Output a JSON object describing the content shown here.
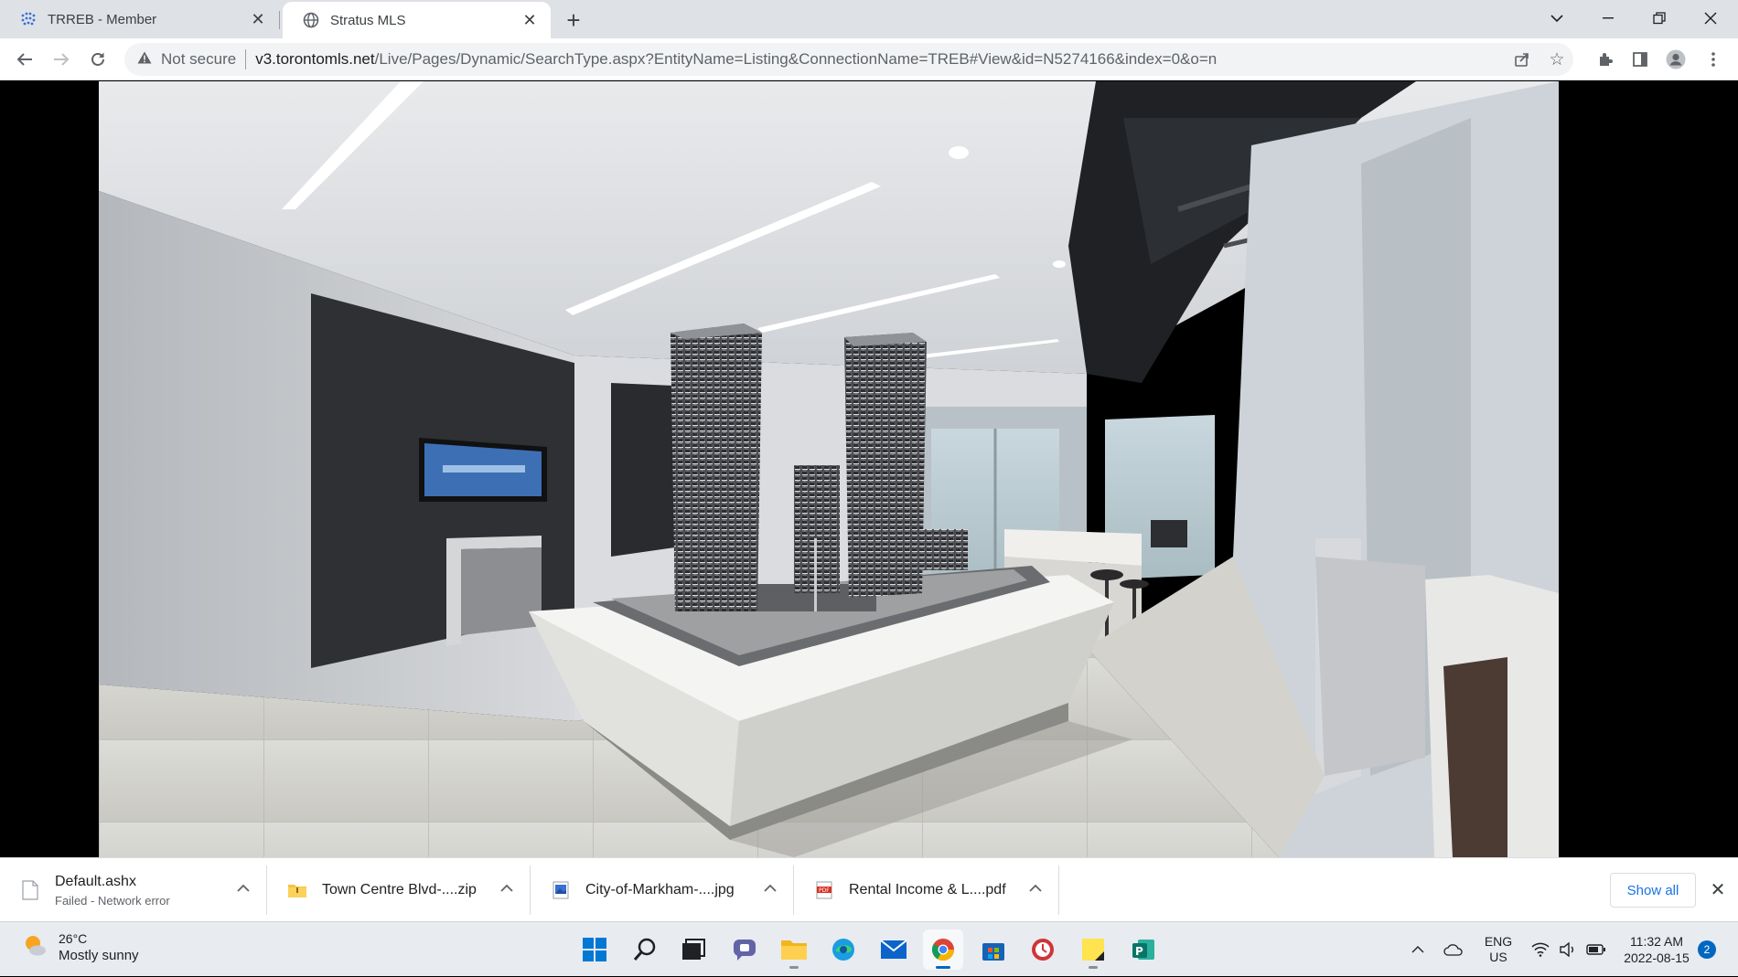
{
  "browser": {
    "tabs": [
      {
        "title": "TRREB - Member",
        "active": false,
        "favicon": "trreb-grid-icon"
      },
      {
        "title": "Stratus MLS",
        "active": true,
        "favicon": "globe-icon"
      }
    ],
    "new_tab_label": "+",
    "window_controls": [
      "tab-search-icon",
      "minimize-icon",
      "restore-icon",
      "close-icon"
    ]
  },
  "toolbar": {
    "nav": [
      "back-icon",
      "forward-icon",
      "reload-icon"
    ],
    "security_label": "Not secure",
    "url_host": "v3.torontomls.net",
    "url_path": "/Live/Pages/Dynamic/SearchType.aspx?EntityName=Listing&ConnectionName=TREB#View&id=N5274166&index=0&o=n",
    "right_icons": [
      "share-icon",
      "bookmark-star-icon",
      "extensions-icon",
      "side-panel-icon",
      "profile-icon",
      "menu-icon"
    ]
  },
  "content": {
    "image_subject": "presentation-centre-photo"
  },
  "downloads": {
    "items": [
      {
        "name": "Default.ashx",
        "status": "Failed - Network error",
        "icon": "file-icon"
      },
      {
        "name": "Town Centre Blvd-....zip",
        "status": "",
        "icon": "zip-folder-icon"
      },
      {
        "name": "City-of-Markham-....jpg",
        "status": "",
        "icon": "image-file-icon"
      },
      {
        "name": "Rental Income & L....pdf",
        "status": "",
        "icon": "pdf-icon"
      }
    ],
    "show_all_label": "Show all"
  },
  "taskbar": {
    "weather": {
      "temp": "26°C",
      "condition": "Mostly sunny"
    },
    "apps": [
      "start",
      "search",
      "task-view",
      "chat",
      "file-explorer",
      "edge",
      "mail",
      "chrome",
      "store",
      "clock-app",
      "sticky-notes",
      "publisher"
    ],
    "lang_top": "ENG",
    "lang_bottom": "US",
    "time": "11:32 AM",
    "date": "2022-08-15",
    "notifications": "2"
  },
  "colors": {
    "tabstrip": "#dee1e6",
    "accent": "#1a73e8",
    "taskbar": "#e8ebf0"
  }
}
